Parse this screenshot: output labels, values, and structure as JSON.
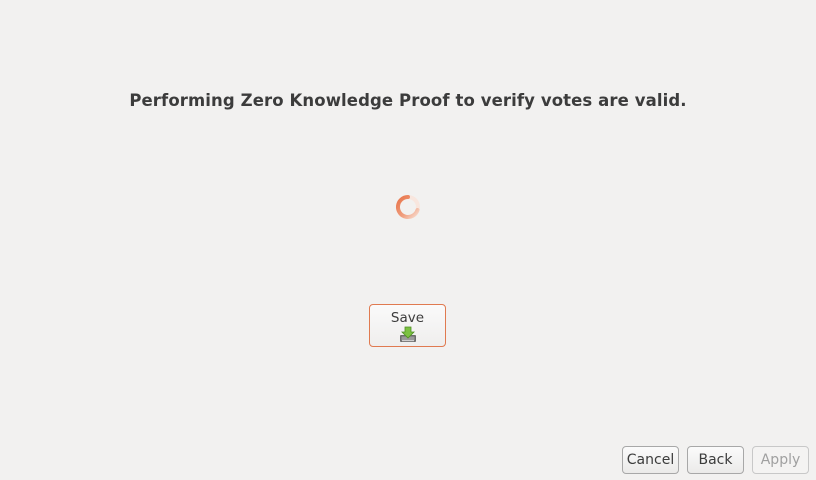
{
  "main": {
    "heading": "Performing Zero Knowledge Proof to verify votes are valid.",
    "spinner_icon": "loading-spinner-icon",
    "save_button": {
      "label": "Save",
      "icon": "download-save-icon"
    }
  },
  "footer": {
    "cancel_label": "Cancel",
    "back_label": "Back",
    "apply_label": "Apply",
    "apply_disabled": true
  },
  "colors": {
    "accent": "#e07a50",
    "background": "#f2f1f0",
    "text": "#3c3c3c",
    "disabled_text": "#a0a0a0"
  }
}
